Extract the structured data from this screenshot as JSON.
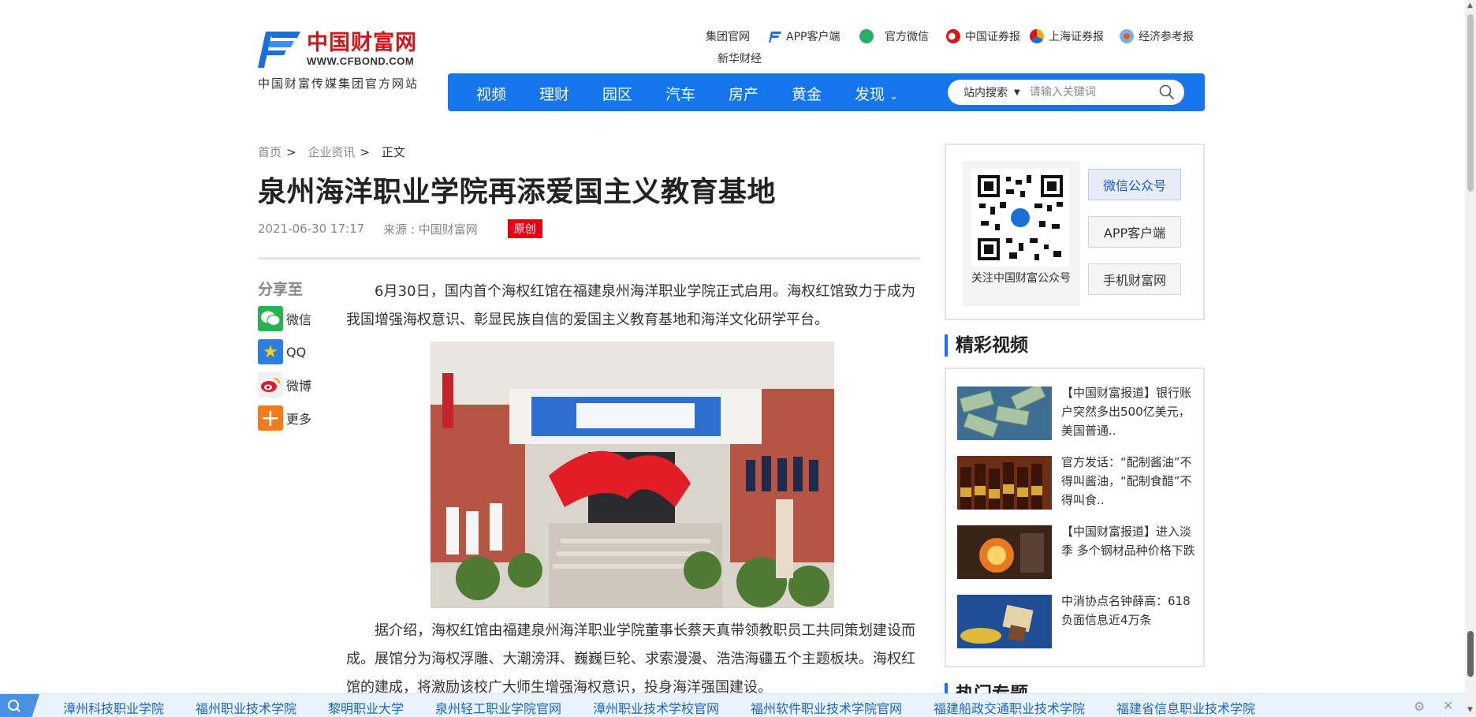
{
  "logo": {
    "name": "中国财富网",
    "url": "WWW.CFBOND.COM",
    "slogan": "中国财富传媒集团官方网站"
  },
  "toplinks": [
    {
      "label": "集团官网",
      "icon": "none"
    },
    {
      "label": "APP客户端",
      "icon": "cfbond-app-icon"
    },
    {
      "label": "官方微信",
      "icon": "wechat-icon"
    },
    {
      "label": "中国证券报",
      "icon": "csj-icon"
    },
    {
      "label": "上海证券报",
      "icon": "ssn-icon"
    },
    {
      "label": "经济参考报",
      "icon": "jjckb-icon"
    },
    {
      "label": "新华财经",
      "icon": "none"
    }
  ],
  "nav": {
    "items": [
      "视频",
      "理财",
      "园区",
      "汽车",
      "房产",
      "黄金",
      "发现"
    ],
    "search_scope": "站内搜索",
    "search_placeholder": "请输入关键词"
  },
  "breadcrumb": [
    "首页",
    "企业资讯",
    "正文"
  ],
  "breadcrumb_sep": ">",
  "article": {
    "title": "泉州海洋职业学院再添爱国主义教育基地",
    "date": "2021-06-30 17:17",
    "source": "来源 : 中国财富网",
    "tag": "原创",
    "p1": "6月30日，国内首个海权红馆在福建泉州海洋职业学院正式启用。海权红馆致力于成为我国增强海权意识、彰显民族自信的爱国主义教育基地和海洋文化研学平台。",
    "p2": "据介绍，海权红馆由福建泉州海洋职业学院董事长蔡天真带领教职员工共同策划建设而成。展馆分为海权浮雕、大潮滂湃、巍巍巨轮、求索漫漫、浩浩海疆五个主题板块。海权红馆的建成，将激励该校广大师生增强海权意识，投身海洋强国建设。"
  },
  "share": {
    "heading": "分享至",
    "items": [
      "微信",
      "QQ",
      "微博",
      "更多"
    ]
  },
  "sidebar": {
    "qr_caption": "关注中国财富公众号",
    "buttons": [
      "微信公众号",
      "APP客户端",
      "手机财富网"
    ],
    "video_heading": "精彩视频",
    "videos": [
      "【中国财富报道】银行账户突然多出500亿美元，美国普通..",
      "官方发话：“配制酱油”不得叫酱油，“配制食醋”不得叫食..",
      "【中国财富报道】进入淡季 多个钢材品种价格下跌",
      "中消协点名钟薛高：618负面信息近4万条"
    ],
    "next_heading": "热门专题"
  },
  "bottombar": {
    "links": [
      "漳州科技职业学院",
      "福州职业技术学院",
      "黎明职业大学",
      "泉州轻工职业学院官网",
      "漳州职业技术学校官网",
      "福州软件职业技术学院官网",
      "福建船政交通职业技术学院",
      "福建省信息职业技术学院"
    ]
  },
  "colors": {
    "nav_blue": "#1475ed",
    "brand_red": "#d61518",
    "tag_red": "#e60012"
  }
}
